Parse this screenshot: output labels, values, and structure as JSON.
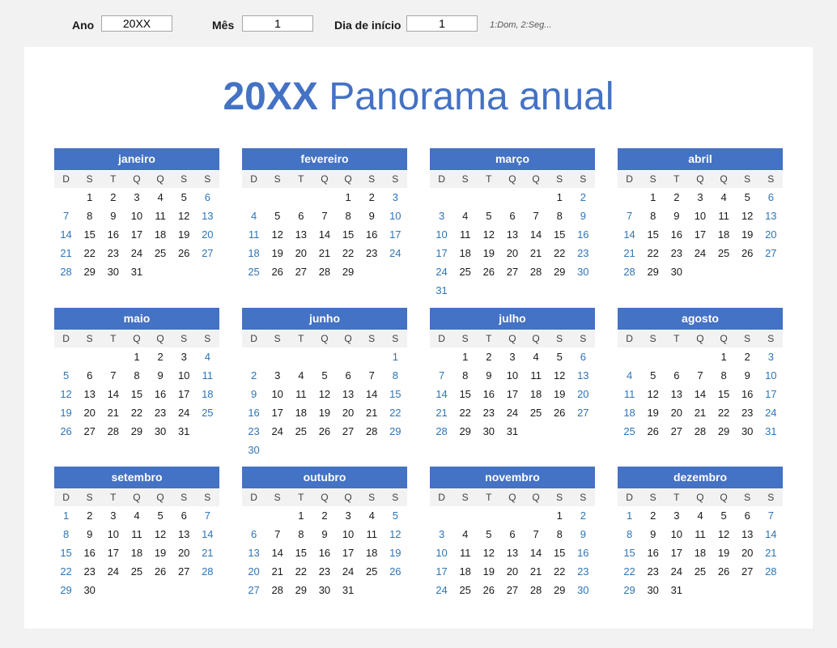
{
  "controls": {
    "year_label": "Ano",
    "year_value": "20XX",
    "month_label": "Mês",
    "month_value": "1",
    "start_label": "Dia de início",
    "start_value": "1",
    "start_hint": "1:Dom, 2:Seg..."
  },
  "title": {
    "year": "20XX",
    "rest": "Panorama anual"
  },
  "colors": {
    "accent": "#4472c4",
    "weekend": "#2e75b6",
    "dow_bg": "#f2f2f2"
  },
  "weekday_headers": [
    "D",
    "S",
    "T",
    "Q",
    "Q",
    "S",
    "S"
  ],
  "months": [
    {
      "name": "janeiro",
      "offset": 1,
      "days": 31
    },
    {
      "name": "fevereiro",
      "offset": 4,
      "days": 29
    },
    {
      "name": "março",
      "offset": 5,
      "days": 31
    },
    {
      "name": "abril",
      "offset": 1,
      "days": 30
    },
    {
      "name": "maio",
      "offset": 3,
      "days": 31
    },
    {
      "name": "junho",
      "offset": 6,
      "days": 30
    },
    {
      "name": "julho",
      "offset": 1,
      "days": 31
    },
    {
      "name": "agosto",
      "offset": 4,
      "days": 31
    },
    {
      "name": "setembro",
      "offset": 0,
      "days": 30
    },
    {
      "name": "outubro",
      "offset": 2,
      "days": 31
    },
    {
      "name": "novembro",
      "offset": 5,
      "days": 30
    },
    {
      "name": "dezembro",
      "offset": 0,
      "days": 31
    }
  ]
}
